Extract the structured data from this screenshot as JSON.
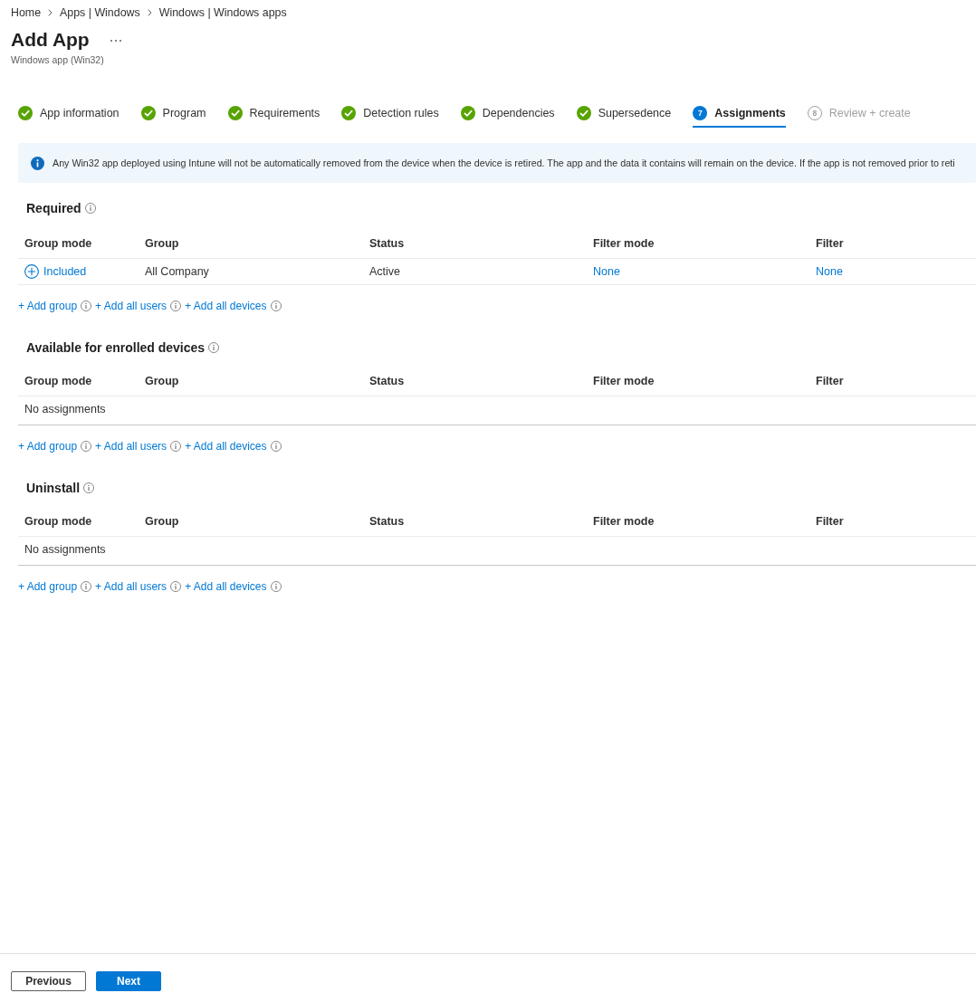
{
  "breadcrumb": [
    {
      "label": "Home"
    },
    {
      "label": "Apps | Windows"
    },
    {
      "label": "Windows | Windows apps"
    }
  ],
  "header": {
    "title": "Add App",
    "subtitle": "Windows app (Win32)"
  },
  "steps": [
    {
      "label": "App information",
      "completed": true,
      "disabled": false,
      "selected": false
    },
    {
      "label": "Program",
      "completed": true,
      "disabled": false,
      "selected": false
    },
    {
      "label": "Requirements",
      "completed": true,
      "disabled": false,
      "selected": false
    },
    {
      "label": "Detection rules",
      "completed": true,
      "disabled": false,
      "selected": false
    },
    {
      "label": "Dependencies",
      "completed": true,
      "disabled": false,
      "selected": false
    },
    {
      "label": "Supersedence",
      "completed": true,
      "disabled": false,
      "selected": false
    },
    {
      "label": "Assignments",
      "number": "7",
      "completed": false,
      "disabled": false,
      "selected": true
    },
    {
      "label": "Review + create",
      "number": "8",
      "completed": false,
      "disabled": true,
      "selected": false
    }
  ],
  "banner": {
    "text": "Any Win32 app deployed using Intune will not be automatically removed from the device when the device is retired. The app and the data it contains will remain on the device. If the app is not removed prior to reti"
  },
  "sections": [
    {
      "title": "Required",
      "columns": [
        "Group mode",
        "Group",
        "Status",
        "Filter mode",
        "Filter"
      ],
      "rows": [
        {
          "cells": [
            {
              "text": "Included",
              "kind": "mode"
            },
            {
              "text": "All Company",
              "kind": "text"
            },
            {
              "text": "Active",
              "kind": "text"
            },
            {
              "text": "None",
              "kind": "link"
            },
            {
              "text": "None",
              "kind": "link"
            }
          ]
        }
      ],
      "actions": [
        {
          "label": "+ Add group"
        },
        {
          "label": "+ Add all users"
        },
        {
          "label": "+ Add all devices"
        }
      ]
    },
    {
      "title": "Available for enrolled devices",
      "columns": [
        "Group mode",
        "Group",
        "Status",
        "Filter mode",
        "Filter"
      ],
      "empty_text": "No assignments",
      "actions": [
        {
          "label": "+ Add group"
        },
        {
          "label": "+ Add all users"
        },
        {
          "label": "+ Add all devices"
        }
      ]
    },
    {
      "title": "Uninstall",
      "columns": [
        "Group mode",
        "Group",
        "Status",
        "Filter mode",
        "Filter"
      ],
      "empty_text": "No assignments",
      "actions": [
        {
          "label": "+ Add group"
        },
        {
          "label": "+ Add all users"
        },
        {
          "label": "+ Add all devices"
        }
      ]
    }
  ],
  "footer": {
    "buttons": [
      {
        "label": "Previous",
        "kind": "back"
      },
      {
        "label": "Next",
        "kind": "next"
      }
    ]
  }
}
